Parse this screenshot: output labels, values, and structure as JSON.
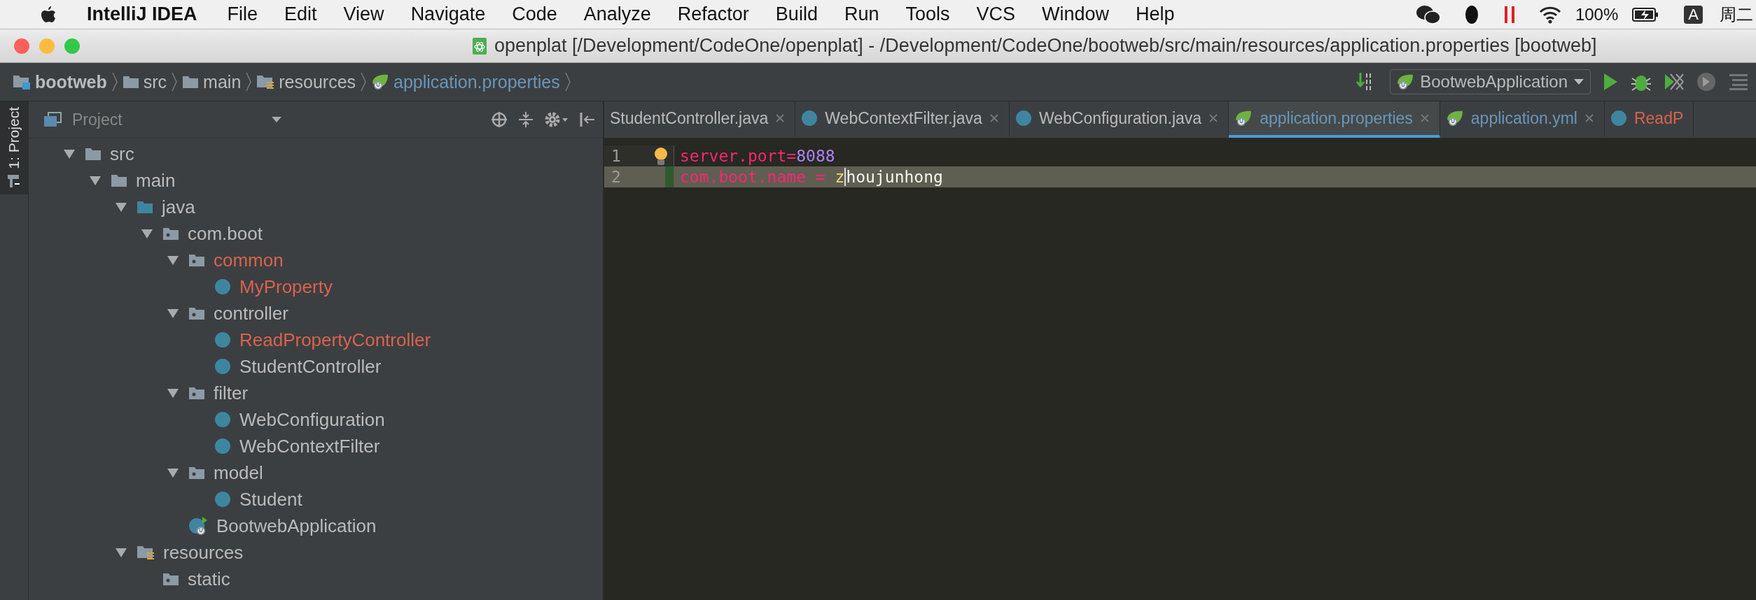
{
  "menu_bar": {
    "app_name": "IntelliJ IDEA",
    "menus": [
      "File",
      "Edit",
      "View",
      "Navigate",
      "Code",
      "Analyze",
      "Refactor",
      "Build",
      "Run",
      "Tools",
      "VCS",
      "Window",
      "Help"
    ],
    "battery": "100%",
    "input_source": "A",
    "day": "周二"
  },
  "window": {
    "title": "openplat [/Development/CodeOne/openplat] - /Development/CodeOne/bootweb/src/main/resources/application.properties [bootweb]"
  },
  "breadcrumbs": [
    {
      "label": "bootweb",
      "kind": "module"
    },
    {
      "label": "src",
      "kind": "folder"
    },
    {
      "label": "main",
      "kind": "folder"
    },
    {
      "label": "resources",
      "kind": "resources"
    },
    {
      "label": "application.properties",
      "kind": "spring"
    }
  ],
  "run_config": {
    "label": "BootwebApplication"
  },
  "tool_stripe": {
    "label": "1: Project"
  },
  "project_panel": {
    "title": "Project",
    "tree": [
      {
        "label": "src",
        "kind": "folder",
        "expanded": true,
        "color": "#bbbbbb",
        "children": [
          {
            "label": "main",
            "kind": "folder",
            "expanded": true,
            "color": "#bbbbbb",
            "children": [
              {
                "label": "java",
                "kind": "source",
                "expanded": true,
                "color": "#bbbbbb",
                "children": [
                  {
                    "label": "com.boot",
                    "kind": "package",
                    "expanded": true,
                    "color": "#bbbbbb",
                    "children": [
                      {
                        "label": "common",
                        "kind": "package",
                        "expanded": true,
                        "color": "#d9634c",
                        "children": [
                          {
                            "label": "MyProperty",
                            "kind": "class",
                            "color": "#d9634c"
                          }
                        ]
                      },
                      {
                        "label": "controller",
                        "kind": "package",
                        "expanded": true,
                        "color": "#bbbbbb",
                        "children": [
                          {
                            "label": "ReadPropertyController",
                            "kind": "class",
                            "color": "#d9634c"
                          },
                          {
                            "label": "StudentController",
                            "kind": "class",
                            "color": "#bbbbbb"
                          }
                        ]
                      },
                      {
                        "label": "filter",
                        "kind": "package",
                        "expanded": true,
                        "color": "#bbbbbb",
                        "children": [
                          {
                            "label": "WebConfiguration",
                            "kind": "class",
                            "color": "#bbbbbb"
                          },
                          {
                            "label": "WebContextFilter",
                            "kind": "class",
                            "color": "#bbbbbb"
                          }
                        ]
                      },
                      {
                        "label": "model",
                        "kind": "package",
                        "expanded": true,
                        "color": "#bbbbbb",
                        "children": [
                          {
                            "label": "Student",
                            "kind": "class",
                            "color": "#bbbbbb"
                          }
                        ]
                      },
                      {
                        "label": "BootwebApplication",
                        "kind": "spring_class",
                        "color": "#bbbbbb"
                      }
                    ]
                  }
                ]
              },
              {
                "label": "resources",
                "kind": "resources",
                "expanded": true,
                "color": "#bbbbbb",
                "children": [
                  {
                    "label": "static",
                    "kind": "package",
                    "color": "#bbbbbb"
                  }
                ]
              }
            ]
          }
        ]
      }
    ]
  },
  "editor_tabs": [
    {
      "label": "StudentController.java",
      "kind": "plain",
      "color": "#bbbbbb",
      "selected": false
    },
    {
      "label": "WebContextFilter.java",
      "kind": "class",
      "color": "#bbbbbb",
      "selected": false
    },
    {
      "label": "WebConfiguration.java",
      "kind": "class",
      "color": "#bbbbbb",
      "selected": false
    },
    {
      "label": "application.properties",
      "kind": "spring",
      "color": "#6897bb",
      "selected": true
    },
    {
      "label": "application.yml",
      "kind": "spring",
      "color": "#6897bb",
      "selected": false
    },
    {
      "label": "ReadP",
      "kind": "class",
      "color": "#d9634c",
      "selected": false
    }
  ],
  "editor": {
    "lines": [
      {
        "number": "1",
        "current": false,
        "changed": false,
        "bulb": true,
        "tokens": [
          {
            "text": "server.port",
            "kind": "key"
          },
          {
            "text": "=",
            "kind": "key"
          },
          {
            "text": "8088",
            "kind": "number"
          }
        ]
      },
      {
        "number": "2",
        "current": true,
        "changed": true,
        "bulb": false,
        "tokens": [
          {
            "text": "com.boot.name",
            "kind": "key"
          },
          {
            "text": " = ",
            "kind": "key"
          },
          {
            "text": "z",
            "kind": "warn",
            "caret_after": true
          },
          {
            "text": "houjunhong",
            "kind": "plain"
          }
        ]
      }
    ]
  }
}
